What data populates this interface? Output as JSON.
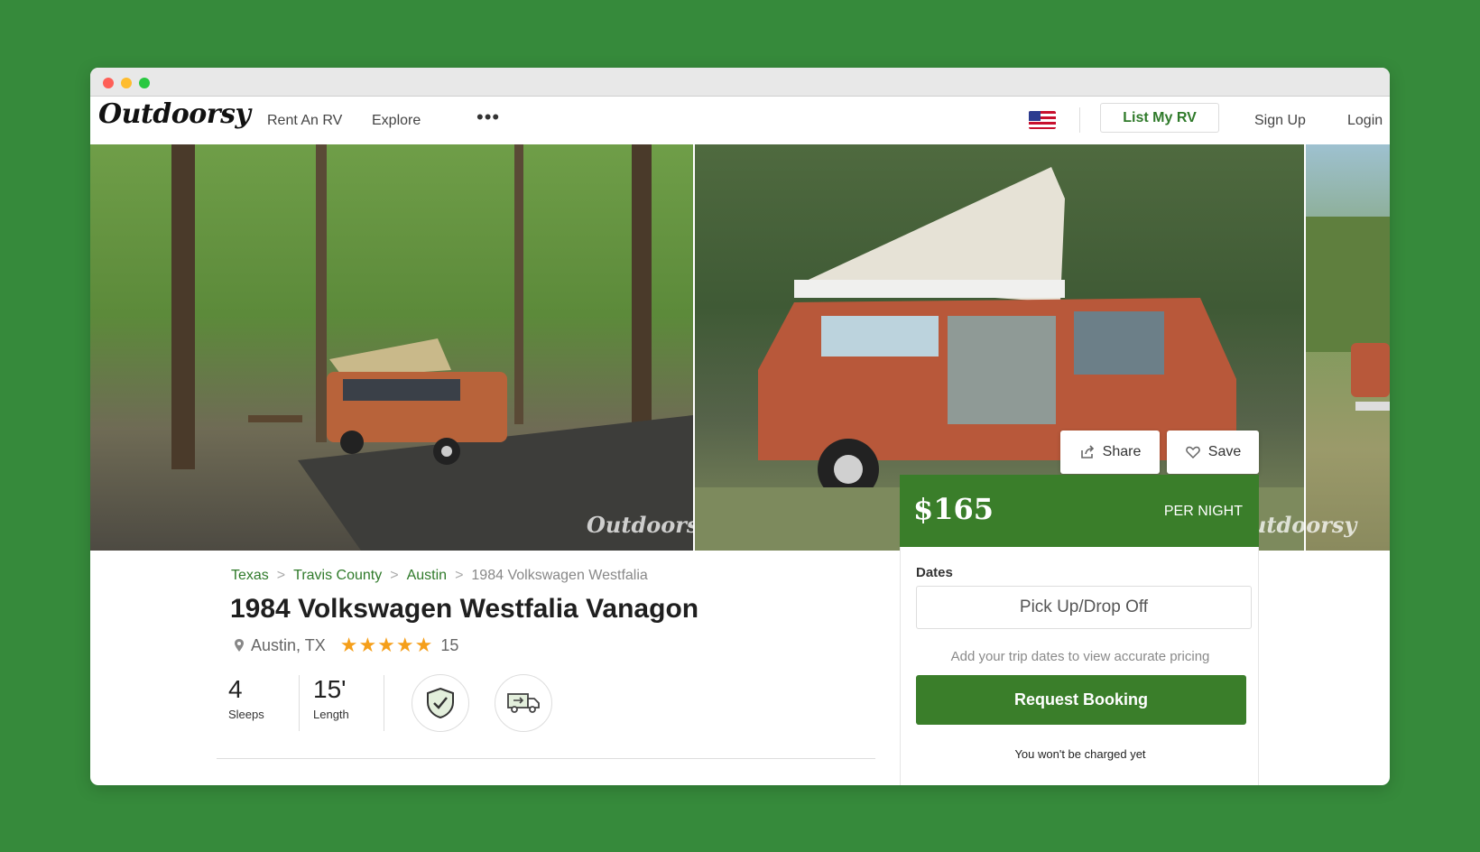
{
  "nav": {
    "logo": "Outdoorsy",
    "links": [
      "Rent An RV",
      "Explore"
    ],
    "more": "•••",
    "list_rv": "List My RV",
    "sign_up": "Sign Up",
    "login": "Login",
    "flag": "us-flag-icon"
  },
  "gallery": {
    "watermark": "Outdoorsy",
    "share_label": "Share",
    "save_label": "Save"
  },
  "pricing": {
    "price": "$165",
    "unit": "PER NIGHT"
  },
  "booking": {
    "dates_label": "Dates",
    "dates_placeholder": "Pick Up/Drop Off",
    "help_text": "Add your trip dates to view accurate pricing",
    "request_button": "Request Booking",
    "no_charge_text": "You won't be charged yet"
  },
  "listing": {
    "breadcrumb": [
      "Texas",
      "Travis County",
      "Austin",
      "1984 Volkswagen Westfalia"
    ],
    "breadcrumb_separator": ">",
    "title": "1984 Volkswagen Westfalia Vanagon",
    "location": "Austin, TX",
    "rating": 5,
    "rating_stars": "★★★★★",
    "review_count": "15",
    "stats": [
      {
        "value": "4",
        "label": "Sleeps"
      },
      {
        "value": "15'",
        "label": "Length"
      }
    ],
    "badges": [
      "shield-check-icon",
      "delivery-truck-icon"
    ]
  },
  "colors": {
    "brand_green": "#3a7e2a",
    "link_green": "#2f7a2a",
    "star": "#f59f1a",
    "page_background": "#368a3b"
  }
}
